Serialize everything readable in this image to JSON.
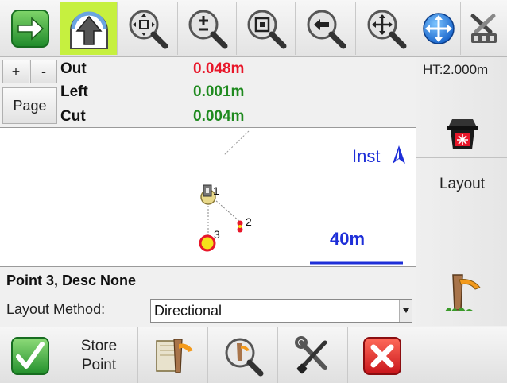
{
  "toolbar": {
    "icons": [
      "next-arrow-icon",
      "north-up-icon",
      "zoom-extents-icon",
      "zoom-in-out-icon",
      "zoom-window-icon",
      "zoom-previous-icon",
      "pan-icon",
      "navigation-icon",
      "settings-tools-icon"
    ]
  },
  "page_nav": {
    "plus": "+",
    "minus": "-",
    "page": "Page"
  },
  "deltas": [
    {
      "label": "Out",
      "value": "0.048m",
      "color": "#e8172a"
    },
    {
      "label": "Left",
      "value": "0.001m",
      "color": "#1f8a1f"
    },
    {
      "label": "Cut",
      "value": "0.004m",
      "color": "#1f8a1f"
    }
  ],
  "instrument": {
    "ht": "HT:2.000m",
    "layout": "Layout"
  },
  "map": {
    "north_label": "Inst",
    "scale_label": "40m",
    "points": [
      {
        "label": "1"
      },
      {
        "label": "2"
      },
      {
        "label": "3"
      }
    ]
  },
  "point_info": {
    "title": "Point 3, Desc None"
  },
  "layout_method": {
    "label": "Layout Method:",
    "value": "Directional"
  },
  "bottom": {
    "store_line1": "Store",
    "store_line2": "Point"
  },
  "colors": {
    "active_tab": "#c6f03f",
    "accent_blue": "#1e2fd8",
    "target_red": "#e8172a",
    "point_yellow": "#f5e21a"
  }
}
